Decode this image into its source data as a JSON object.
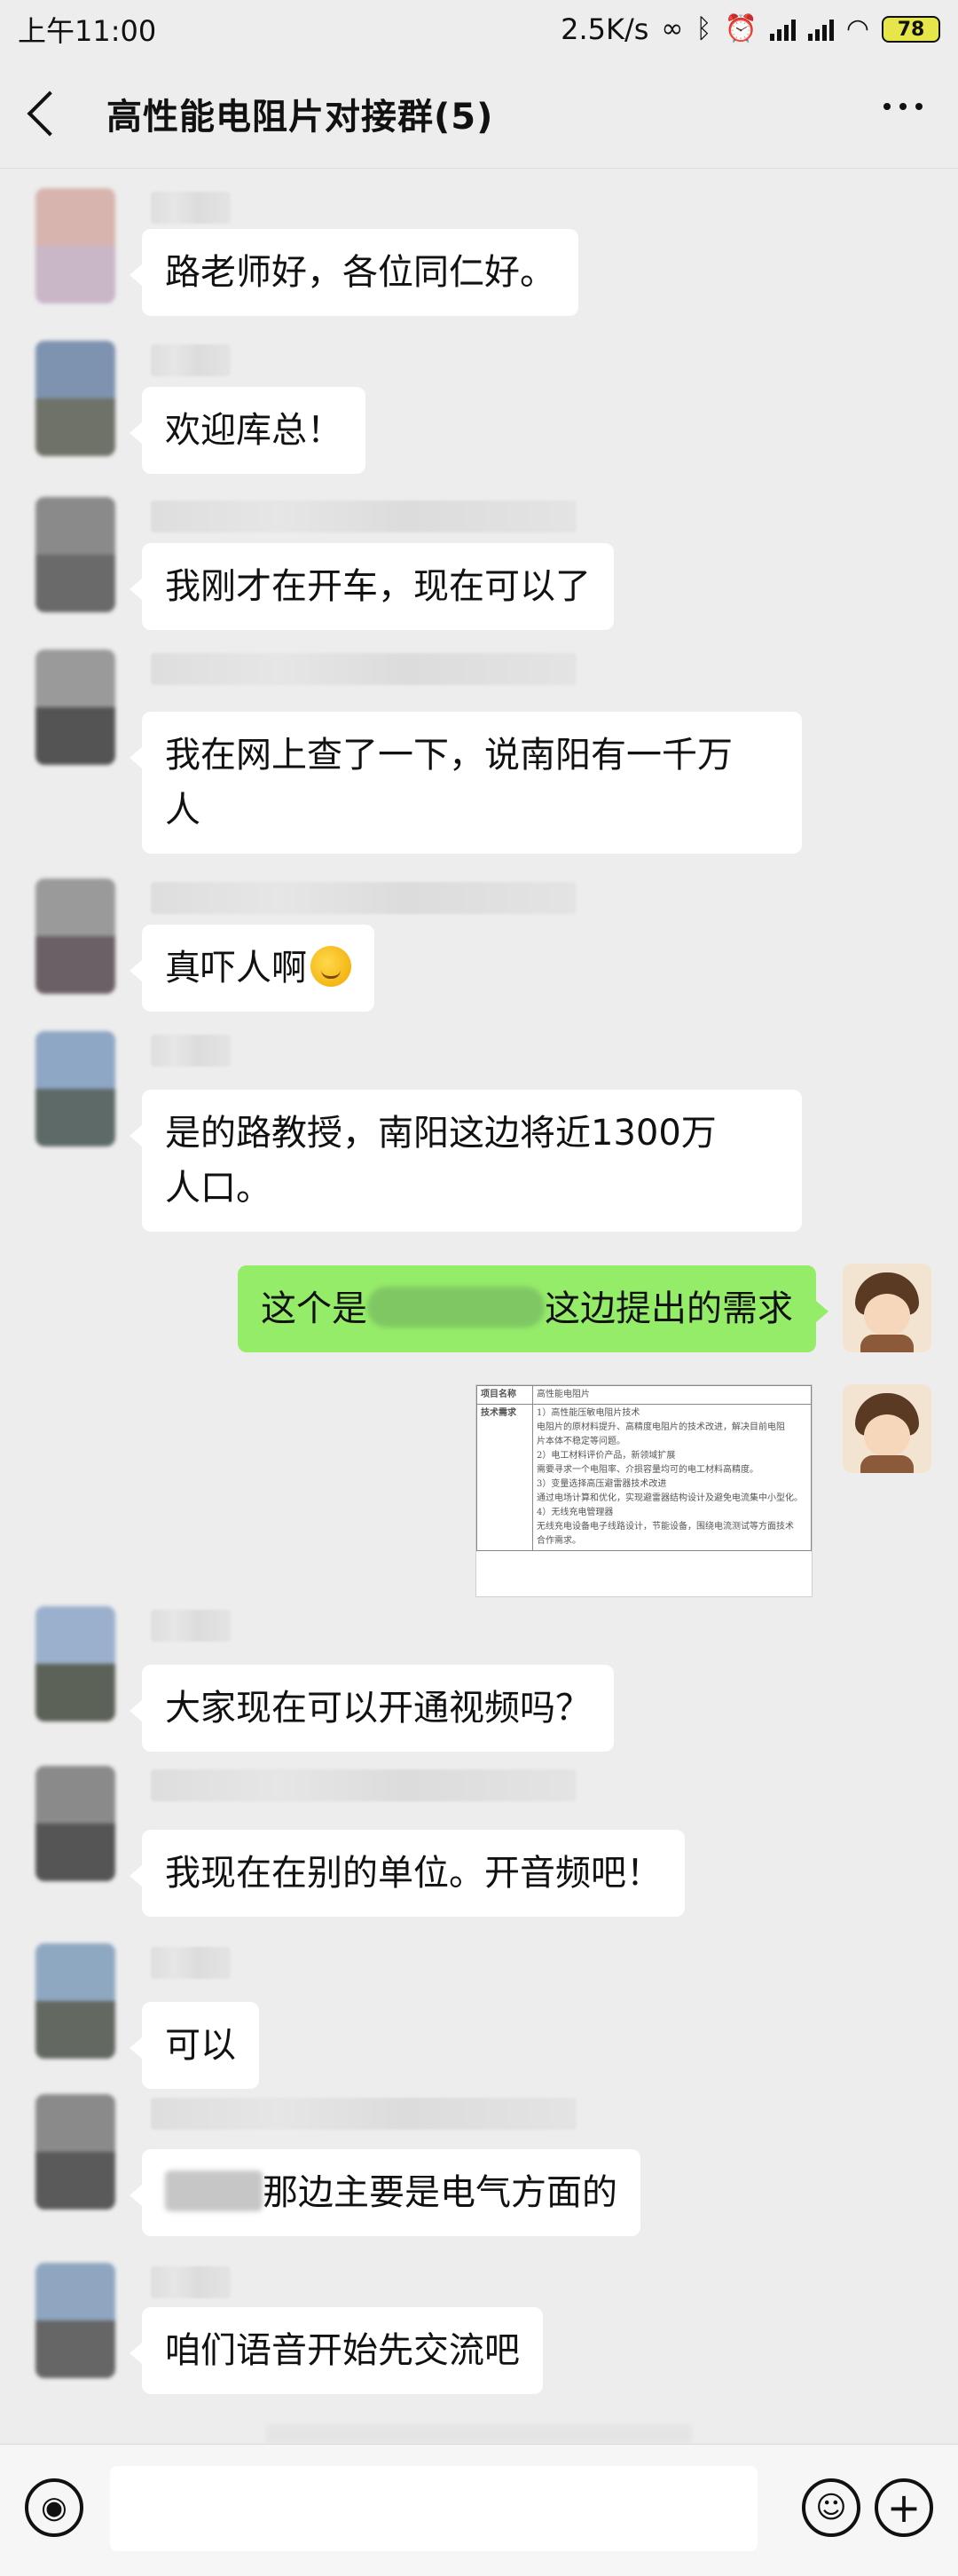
{
  "status_bar": {
    "time": "上午11:00",
    "network_speed": "2.5K/s",
    "battery": "78",
    "icons": [
      "link-icon",
      "bluetooth-icon",
      "alarm-icon",
      "signal-icon",
      "signal-icon",
      "wifi-icon",
      "battery-icon"
    ]
  },
  "header": {
    "title": "高性能电阻片对接群(5)",
    "icons": [
      "back-icon",
      "more-icon"
    ]
  },
  "messages": [
    {
      "type": "received",
      "text": "路老师好，各位同仁好。"
    },
    {
      "type": "received",
      "text": "欢迎库总！"
    },
    {
      "type": "received",
      "text": "我刚才在开车，现在可以了"
    },
    {
      "type": "received",
      "text_line1": "我在网上查了一下，说南阳有一千万",
      "text_line2": "人"
    },
    {
      "type": "received",
      "text": "真吓人啊",
      "emoji": "thinking-face-emoji"
    },
    {
      "type": "received",
      "text_line1": "是的路教授，南阳这边将近1300万",
      "text_line2": "人口。"
    },
    {
      "type": "sent",
      "text_before": "这个是",
      "text_after": "这边提出的需求"
    },
    {
      "type": "sent_image",
      "doc": {
        "row1_label": "项目名称",
        "row1_value": "高性能电阻片",
        "row2_label": "技术需求",
        "lines": [
          "1）高性能压敏电阻片技术",
          "电阻片的原材料提升、高精度电阻片的技术改进，解决目前电阻",
          "片本体不稳定等问题。",
          "2）电工材料评价产品，新领域扩展",
          "需要寻求一个电阻率、介损容量均可的电工材料高精度。",
          "3）变量选择高压避雷器技术改进",
          "通过电场计算和优化，实现避雷器结构设计及避免电流集中小型化。",
          "4）无线充电管理器",
          "无线充电设备电子线路设计，节能设备，围绕电流测试等方面技术",
          "合作需求。"
        ]
      }
    },
    {
      "type": "received",
      "text": "大家现在可以开通视频吗？"
    },
    {
      "type": "received",
      "text": "我现在在别的单位。开音频吧！"
    },
    {
      "type": "received",
      "text": "可以"
    },
    {
      "type": "received",
      "text": "那边主要是电气方面的"
    },
    {
      "type": "received",
      "text": "咱们语音开始先交流吧"
    }
  ],
  "input_bar": {
    "icons": [
      "voice-icon",
      "emoji-icon",
      "plus-icon"
    ]
  },
  "colors": {
    "background": "#ededed",
    "sent_bubble": "#95ec69",
    "received_bubble": "#ffffff"
  }
}
